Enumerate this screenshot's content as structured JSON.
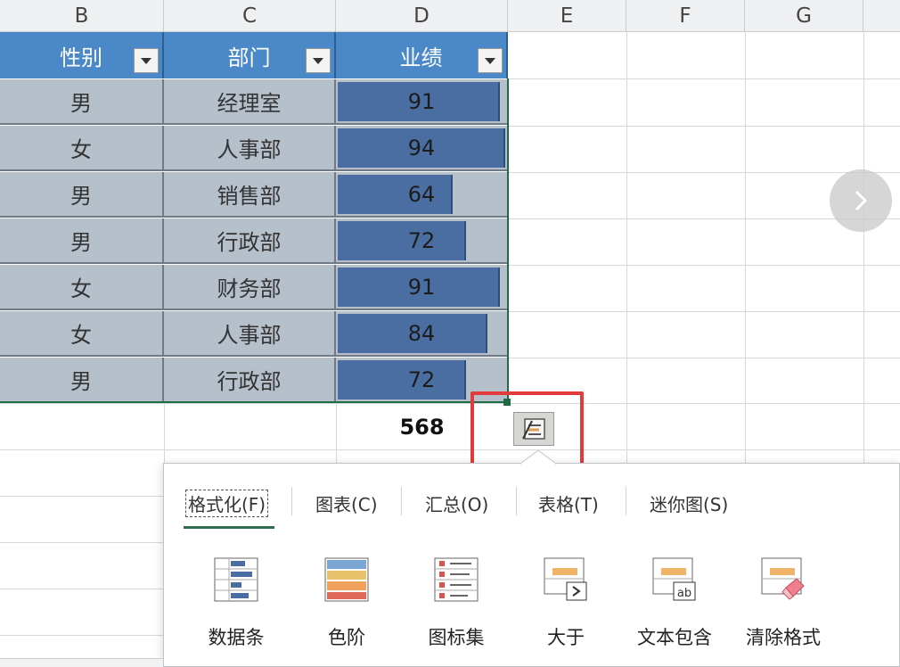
{
  "columns": [
    "B",
    "C",
    "D",
    "E",
    "F",
    "G"
  ],
  "table": {
    "headers": [
      "性别",
      "部门",
      "业绩"
    ],
    "rows": [
      {
        "gender": "男",
        "dept": "经理室",
        "score": "91"
      },
      {
        "gender": "女",
        "dept": "人事部",
        "score": "94"
      },
      {
        "gender": "男",
        "dept": "销售部",
        "score": "64"
      },
      {
        "gender": "男",
        "dept": "行政部",
        "score": "72"
      },
      {
        "gender": "女",
        "dept": "财务部",
        "score": "91"
      },
      {
        "gender": "女",
        "dept": "人事部",
        "score": "84"
      },
      {
        "gender": "男",
        "dept": "行政部",
        "score": "72"
      }
    ],
    "bar_max": 94,
    "total": "568"
  },
  "quick_analysis": {
    "tabs": [
      "格式化(F)",
      "图表(C)",
      "汇总(O)",
      "表格(T)",
      "迷你图(S)"
    ],
    "active_tab": "格式化(F)",
    "tools": [
      "数据条",
      "色阶",
      "图标集",
      "大于",
      "文本包含",
      "清除格式"
    ]
  },
  "colors": {
    "header_bg": "#4a88c8",
    "cell_bg": "#b6c0cb",
    "databar": "#4a6ea1",
    "highlight": "#e23b3b",
    "active_tab_underline": "#2e6b4f"
  },
  "icons": [
    "filter-dropdown-icon",
    "quick-analysis-icon",
    "next-arrow-icon",
    "data-bars-icon",
    "color-scale-icon",
    "icon-set-icon",
    "greater-than-icon",
    "text-contains-icon",
    "clear-format-icon"
  ]
}
